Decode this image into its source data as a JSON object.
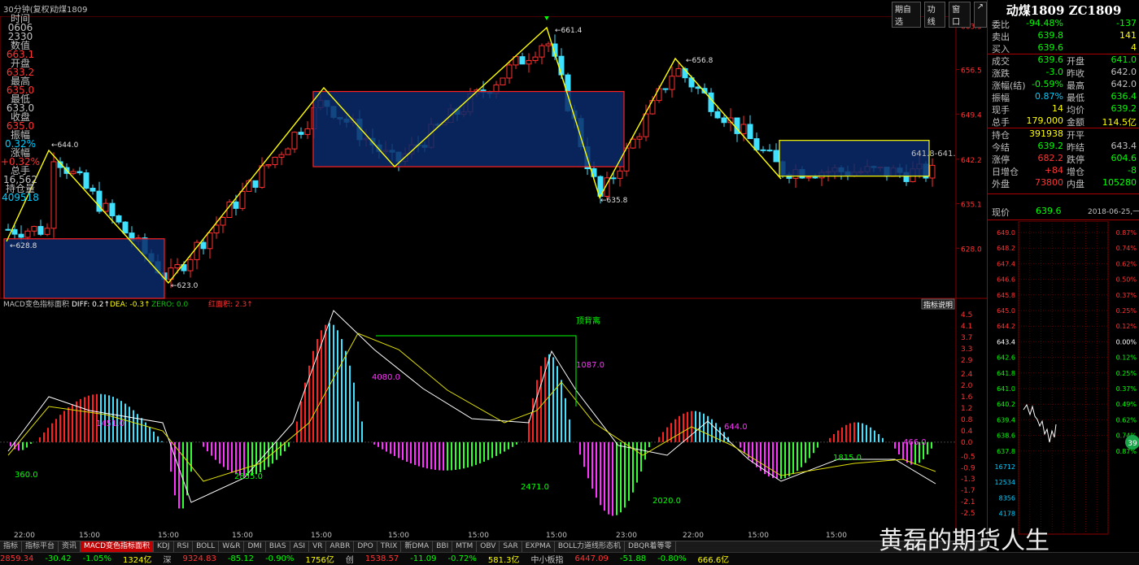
{
  "window": {
    "period_label": "30分钟(复权)",
    "symbol_label": "动煤1809",
    "buttons": [
      "期自选",
      "功线",
      "窗口",
      "↗"
    ]
  },
  "left_panel": {
    "rows": [
      {
        "text": "时间",
        "color": "#c0c0c0"
      },
      {
        "text": "0606",
        "color": "#c0c0c0"
      },
      {
        "text": "2330",
        "color": "#c0c0c0"
      },
      {
        "text": "数值",
        "color": "#c0c0c0"
      },
      {
        "text": "663.1",
        "color": "#ff3333"
      },
      {
        "text": "开盘",
        "color": "#c0c0c0"
      },
      {
        "text": "633.2",
        "color": "#ff3333"
      },
      {
        "text": "最高",
        "color": "#c0c0c0"
      },
      {
        "text": "635.0",
        "color": "#ff3333"
      },
      {
        "text": "最低",
        "color": "#c0c0c0"
      },
      {
        "text": "633.0",
        "color": "#c0c0c0"
      },
      {
        "text": "收盘",
        "color": "#c0c0c0"
      },
      {
        "text": "635.0",
        "color": "#ff3333"
      },
      {
        "text": "振幅",
        "color": "#c0c0c0"
      },
      {
        "text": "0.32%",
        "color": "#00ccff"
      },
      {
        "text": "涨幅",
        "color": "#c0c0c0"
      },
      {
        "text": "+0.32%",
        "color": "#ff3333"
      },
      {
        "text": "总手",
        "color": "#c0c0c0"
      },
      {
        "text": "16,562",
        "color": "#c0c0c0"
      },
      {
        "text": "持仓量",
        "color": "#c0c0c0"
      },
      {
        "text": "409518",
        "color": "#00ccff"
      }
    ]
  },
  "main_chart": {
    "price_axis": [
      "663.5",
      "656.5",
      "649.4",
      "642.2",
      "635.1",
      "628.0"
    ],
    "peak_labels": [
      "644.0",
      "628.8",
      "623.0",
      "661.4",
      "656.8",
      "635.8",
      "641.8",
      "641."
    ],
    "current_price_label": "641.8-641."
  },
  "chart_data": [
    {
      "type": "candlestick",
      "title": "",
      "ylim": [
        620,
        665
      ],
      "x_ticks": [
        "22:00",
        "15:00",
        "15:00",
        "15:00",
        "15:00",
        "23:00",
        "22:00",
        "15:00",
        "15:00",
        "15:00"
      ],
      "swing_points": [
        {
          "label": "644.0",
          "value": 644.0
        },
        {
          "label": "623.0",
          "value": 623.0
        },
        {
          "label": "661.4",
          "value": 661.4
        },
        {
          "label": "635.8",
          "value": 635.8
        },
        {
          "label": "656.8",
          "value": 656.8
        }
      ],
      "boxes": [
        {
          "low": 620,
          "high": 629.5
        },
        {
          "low": 641,
          "high": 653
        },
        {
          "low": 639.5,
          "high": 645.2
        }
      ]
    },
    {
      "type": "bar",
      "title": "MACD",
      "legend": {
        "name": "MACD变色指标面积",
        "diff": "DIFF: 0.2↑",
        "dea": "DEA: -0.3↑",
        "zero": "ZERO: 0.0",
        "area": "红面积: 2.3↑"
      },
      "ylim": [
        -2.9,
        4.7
      ],
      "y_ticks": [
        "4.5",
        "4.1",
        "3.7",
        "3.3",
        "2.9",
        "2.4",
        "2.0",
        "1.6",
        "1.2",
        "0.8",
        "0.4",
        "0.0",
        "-0.5",
        "-0.9",
        "-1.3",
        "-1.7",
        "-2.1",
        "-2.5"
      ],
      "area_labels": [
        "360.0",
        "1451.0",
        "2855.0",
        "4080.0",
        "2471.0",
        "1087.0",
        "2020.0",
        "644.0",
        "1815.0",
        "466.0"
      ],
      "annotation": "顶背离",
      "button": "指标说明"
    }
  ],
  "tabs": [
    "指标",
    "指标平台",
    "资讯",
    "MACD变色指标面积",
    "KDJ",
    "RSI",
    "BOLL",
    "W&R",
    "DMI",
    "BIAS",
    "ASI",
    "VR",
    "ARBR",
    "DPO",
    "TRIX",
    "新DMA",
    "BBI",
    "MTM",
    "OBV",
    "SAR",
    "EXPMA",
    "BOLL力道线形态机",
    "DBQR着等零"
  ],
  "right_panel": {
    "title": "动煤1809 ZC1809",
    "rows": [
      [
        {
          "t": "委比",
          "c": "#c0c0c0"
        },
        {
          "t": "-94.48%",
          "c": "#00ff00"
        },
        {
          "t": "",
          "c": "#c0c0c0"
        },
        {
          "t": "-137",
          "c": "#00ff00"
        }
      ],
      [
        {
          "t": "卖出",
          "c": "#c0c0c0"
        },
        {
          "t": "639.8",
          "c": "#00ff00"
        },
        {
          "t": "",
          "c": "#c0c0c0"
        },
        {
          "t": "141",
          "c": "#ffff00"
        }
      ],
      [
        {
          "t": "买入",
          "c": "#c0c0c0"
        },
        {
          "t": "639.6",
          "c": "#00ff00"
        },
        {
          "t": "",
          "c": "#c0c0c0"
        },
        {
          "t": "4",
          "c": "#ffff00"
        }
      ],
      [
        {
          "t": "成交",
          "c": "#c0c0c0"
        },
        {
          "t": "639.6",
          "c": "#00ff00"
        },
        {
          "t": "开盘",
          "c": "#c0c0c0"
        },
        {
          "t": "641.0",
          "c": "#00ff00"
        }
      ],
      [
        {
          "t": "涨跌",
          "c": "#c0c0c0"
        },
        {
          "t": "-3.0",
          "c": "#00ff00"
        },
        {
          "t": "昨收",
          "c": "#c0c0c0"
        },
        {
          "t": "642.0",
          "c": "#c0c0c0"
        }
      ],
      [
        {
          "t": "涨幅(结)",
          "c": "#c0c0c0"
        },
        {
          "t": "-0.59%",
          "c": "#00ff00"
        },
        {
          "t": "最高",
          "c": "#c0c0c0"
        },
        {
          "t": "642.0",
          "c": "#c0c0c0"
        }
      ],
      [
        {
          "t": "振幅",
          "c": "#c0c0c0"
        },
        {
          "t": "0.87%",
          "c": "#00ccff"
        },
        {
          "t": "最低",
          "c": "#c0c0c0"
        },
        {
          "t": "636.4",
          "c": "#00ff00"
        }
      ],
      [
        {
          "t": "现手",
          "c": "#c0c0c0"
        },
        {
          "t": "14",
          "c": "#ffff00"
        },
        {
          "t": "均价",
          "c": "#c0c0c0"
        },
        {
          "t": "639.2",
          "c": "#00ff00"
        }
      ],
      [
        {
          "t": "总手",
          "c": "#c0c0c0"
        },
        {
          "t": "179,000",
          "c": "#ffff00"
        },
        {
          "t": "金额",
          "c": "#c0c0c0"
        },
        {
          "t": "114.5亿",
          "c": "#ffff00"
        }
      ],
      [
        {
          "t": "持仓",
          "c": "#c0c0c0"
        },
        {
          "t": "391938",
          "c": "#ffff00"
        },
        {
          "t": "开平",
          "c": "#c0c0c0"
        },
        {
          "t": "",
          "c": "#c0c0c0"
        }
      ],
      [
        {
          "t": "今结",
          "c": "#c0c0c0"
        },
        {
          "t": "639.2",
          "c": "#00ff00"
        },
        {
          "t": "昨结",
          "c": "#c0c0c0"
        },
        {
          "t": "643.4",
          "c": "#c0c0c0"
        }
      ],
      [
        {
          "t": "涨停",
          "c": "#c0c0c0"
        },
        {
          "t": "682.2",
          "c": "#ff3333"
        },
        {
          "t": "跌停",
          "c": "#c0c0c0"
        },
        {
          "t": "604.6",
          "c": "#00ff00"
        }
      ],
      [
        {
          "t": "日增仓",
          "c": "#c0c0c0"
        },
        {
          "t": "+84",
          "c": "#ff3333"
        },
        {
          "t": "增仓",
          "c": "#c0c0c0"
        },
        {
          "t": "-8",
          "c": "#00ff00"
        }
      ],
      [
        {
          "t": "外盘",
          "c": "#c0c0c0"
        },
        {
          "t": "73800",
          "c": "#ff3333"
        },
        {
          "t": "内盘",
          "c": "#c0c0c0"
        },
        {
          "t": "105280",
          "c": "#00ff00"
        }
      ]
    ],
    "price_now_label": "现价",
    "price_now": "639.6",
    "timestamp": "2018-06-25,一",
    "mini_left_axis": [
      "649.0",
      "648.2",
      "647.4",
      "646.6",
      "645.8",
      "645.0",
      "644.2",
      "643.4",
      "642.6",
      "641.8",
      "641.0",
      "640.2",
      "639.4",
      "638.6",
      "637.8",
      "16712",
      "12534",
      "8356",
      "4178"
    ],
    "mini_right_axis": [
      "0.87%",
      "0.74%",
      "0.62%",
      "0.50%",
      "0.37%",
      "0.25%",
      "0.12%",
      "0.00%",
      "0.12%",
      "0.25%",
      "0.37%",
      "0.49%",
      "0.62%",
      "0.74%",
      "0.87%"
    ],
    "badge": "39"
  },
  "status_bar": [
    {
      "t": "2859.34",
      "c": "#ff3333"
    },
    {
      "t": "-30.42",
      "c": "#00ff00"
    },
    {
      "t": "-1.05%",
      "c": "#00ff00"
    },
    {
      "t": "1324亿",
      "c": "#ffff00"
    },
    {
      "t": "深",
      "c": "#c0c0c0"
    },
    {
      "t": "9324.83",
      "c": "#ff3333"
    },
    {
      "t": "-85.12",
      "c": "#00ff00"
    },
    {
      "t": "-0.90%",
      "c": "#00ff00"
    },
    {
      "t": "1756亿",
      "c": "#ffff00"
    },
    {
      "t": "创",
      "c": "#c0c0c0"
    },
    {
      "t": "1538.57",
      "c": "#ff3333"
    },
    {
      "t": "-11.09",
      "c": "#00ff00"
    },
    {
      "t": "-0.72%",
      "c": "#00ff00"
    },
    {
      "t": "581.3亿",
      "c": "#ffff00"
    },
    {
      "t": "中小板指",
      "c": "#c0c0c0"
    },
    {
      "t": "6447.09",
      "c": "#ff3333"
    },
    {
      "t": "-51.88",
      "c": "#00ff00"
    },
    {
      "t": "-0.80%",
      "c": "#00ff00"
    },
    {
      "t": "666.6亿",
      "c": "#ffff00"
    }
  ],
  "watermark": "黄磊的期货人生"
}
